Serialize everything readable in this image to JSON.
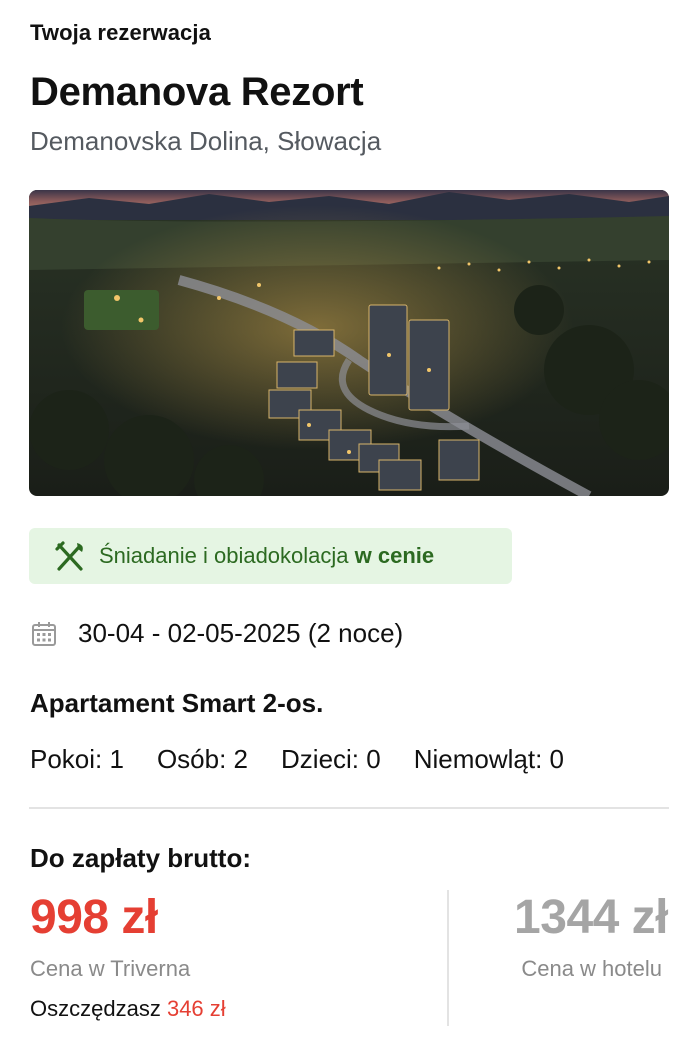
{
  "reservation": {
    "section_label": "Twoja rezerwacja",
    "hotel_name": "Demanova Rezort",
    "location": "Demanovska Dolina, Słowacja"
  },
  "meal": {
    "icon": "fork-knife-icon",
    "text": "Śniadanie i obiadokolacja",
    "suffix": "w cenie",
    "badge_color": "#e5f5e3",
    "text_color": "#2c6a21"
  },
  "stay": {
    "icon": "calendar-icon",
    "dates": "30-04 - 02-05-2025 (2 noce)",
    "room": "Apartament Smart 2-os.",
    "counts": [
      {
        "label": "Pokoi: 1"
      },
      {
        "label": "Osób: 2"
      },
      {
        "label": "Dzieci: 0"
      },
      {
        "label": "Niemowląt: 0"
      }
    ]
  },
  "payment": {
    "label": "Do zapłaty brutto:",
    "our_price": "998 zł",
    "our_price_label": "Cena w Triverna",
    "savings_prefix": "Oszczędzasz",
    "savings_amount": "346 zł",
    "hotel_price": "1344 zł",
    "hotel_price_label": "Cena w hotelu",
    "accent_color": "#e53f33"
  }
}
